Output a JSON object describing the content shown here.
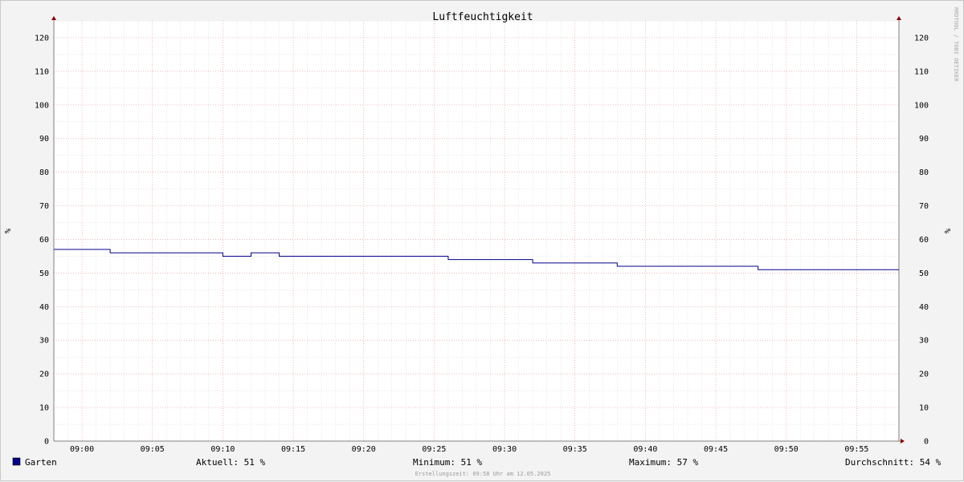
{
  "chart_data": {
    "type": "line",
    "title": "Luftfeuchtigkeit",
    "ylabel": "%",
    "ylim": [
      0,
      125
    ],
    "yticks": [
      0,
      10,
      20,
      30,
      40,
      50,
      60,
      70,
      80,
      90,
      100,
      110,
      120
    ],
    "xlim": [
      "08:58",
      "09:58"
    ],
    "xticks": [
      "09:00",
      "09:05",
      "09:10",
      "09:15",
      "09:20",
      "09:25",
      "09:30",
      "09:35",
      "09:40",
      "09:45",
      "09:50",
      "09:55"
    ],
    "grid": true,
    "series": [
      {
        "name": "Garten",
        "color": "#00008b",
        "step": true,
        "x": [
          "08:58",
          "09:02",
          "09:10",
          "09:12",
          "09:14",
          "09:26",
          "09:32",
          "09:38",
          "09:48",
          "09:58"
        ],
        "y": [
          57,
          56,
          55,
          56,
          55,
          54,
          53,
          52,
          51,
          51
        ]
      }
    ]
  },
  "legend": {
    "series_name": "Garten",
    "swatch_color": "#00008b",
    "current": "Aktuell:  51 %",
    "minimum": "Minimum:  51 %",
    "maximum": "Maximum:  57 %",
    "average": "Durchschnitt:  54 %"
  },
  "footer": "Erstellungszeit: 09:58 Uhr am 12.05.2025",
  "watermark": "RRDTOOL / TOBI OETIKER",
  "colors": {
    "background": "#f3f3f3",
    "plot_background": "#ffffff",
    "minor_grid": "#cfcfcf",
    "major_grid": "#e8a0a0",
    "axis": "#808080",
    "arrow": "#8b0000"
  }
}
